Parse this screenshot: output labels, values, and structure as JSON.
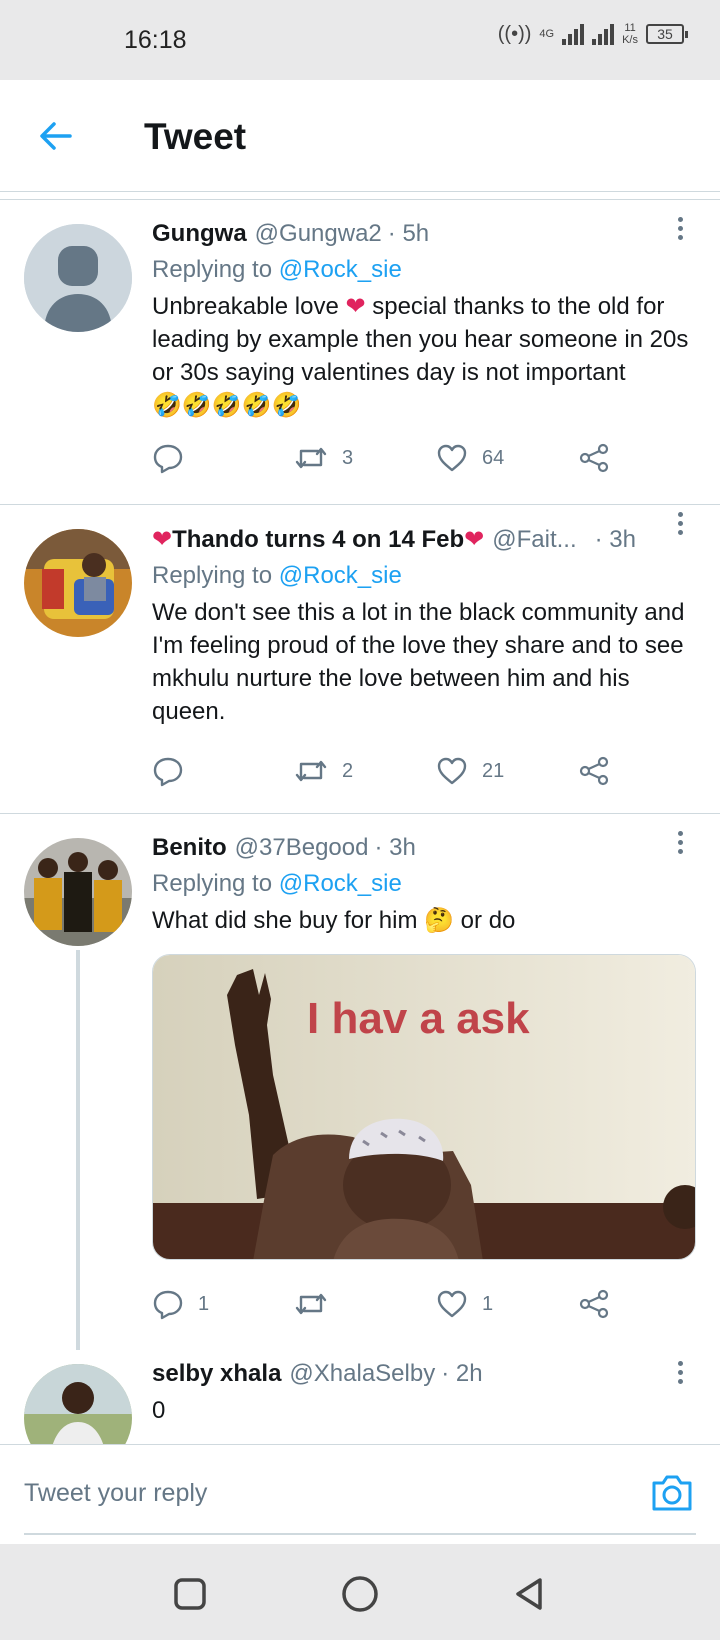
{
  "status_bar": {
    "time": "16:18",
    "network": "4G",
    "speed_value": "11",
    "speed_unit": "K/s",
    "battery": "35"
  },
  "header": {
    "title": "Tweet"
  },
  "tweets": [
    {
      "name": "Gungwa",
      "handle": "@Gungwa2",
      "time": "· 5h",
      "replying_prefix": "Replying to",
      "replying_handle": "@Rock_sie",
      "text_part1": "Unbreakable love ",
      "text_part2": " special thanks to the old for leading by example then you hear someone in 20s or 30s saying valentines day is not important",
      "emoji_line": "🤣🤣🤣🤣🤣",
      "retweets": "3",
      "likes": "64"
    },
    {
      "name": "Thando turns 4 on 14 Feb",
      "handle": "@Fait...",
      "time": "· 3h",
      "replying_prefix": "Replying to",
      "replying_handle": "@Rock_sie",
      "text": "We don't see this a lot in the black community and I'm feeling proud of the love they share and to see mkhulu nurture the love between him and his queen.",
      "retweets": "2",
      "likes": "21"
    },
    {
      "name": "Benito",
      "handle": "@37Begood",
      "time": "· 3h",
      "replying_prefix": "Replying to",
      "replying_handle": "@Rock_sie",
      "text_part1": "What did she buy for him ",
      "text_part2": " or do",
      "image_caption": "I hav a ask",
      "replies": "1",
      "likes": "1"
    },
    {
      "name": "selby xhala",
      "handle": "@XhalaSelby",
      "time": "· 2h",
      "text": "0"
    }
  ],
  "reply_bar": {
    "placeholder": "Tweet your reply"
  },
  "colors": {
    "accent": "#1da1f2",
    "muted": "#657786",
    "heart": "#e0245e",
    "divider": "#cfd9de"
  }
}
